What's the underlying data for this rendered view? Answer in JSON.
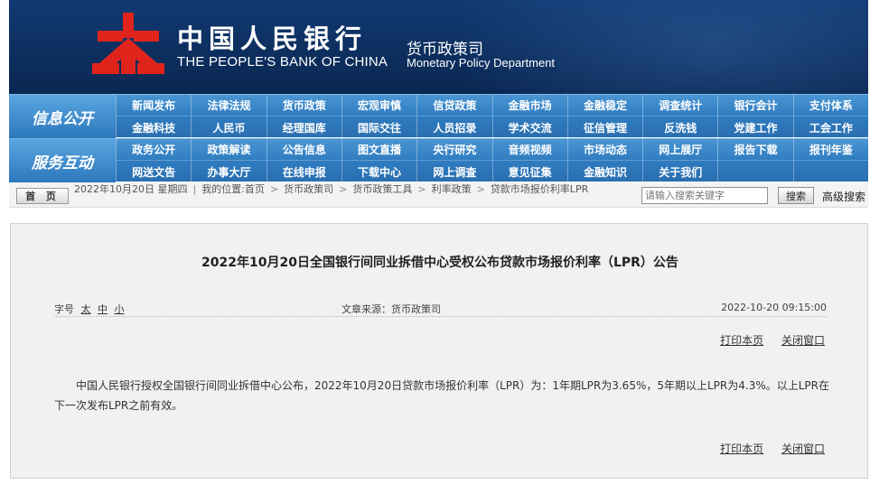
{
  "header": {
    "bank_name_cn": "中国人民银行",
    "bank_name_en": "THE PEOPLE'S BANK OF CHINA",
    "dept_cn": "货币政策司",
    "dept_en": "Monetary Policy Department",
    "colors": {
      "banner": "#0d2f5f",
      "emblem": "#e0241b",
      "nav": "#2f7cc0"
    }
  },
  "nav": {
    "info": {
      "title": "信息公开",
      "items": [
        "新闻发布",
        "法律法规",
        "货币政策",
        "宏观审慎",
        "信贷政策",
        "金融市场",
        "金融稳定",
        "调查统计",
        "银行会计",
        "支付体系",
        "金融科技",
        "人民币",
        "经理国库",
        "国际交往",
        "人员招录",
        "学术交流",
        "征信管理",
        "反洗钱",
        "党建工作",
        "工会工作"
      ]
    },
    "service": {
      "title": "服务互动",
      "items": [
        "政务公开",
        "政策解读",
        "公告信息",
        "图文直播",
        "央行研究",
        "音频视频",
        "市场动态",
        "网上展厅",
        "报告下载",
        "报刊年鉴",
        "网送文告",
        "办事大厅",
        "在线申报",
        "下载中心",
        "网上调查",
        "意见征集",
        "金融知识",
        "关于我们"
      ]
    }
  },
  "crumb": {
    "home": "首 页",
    "date": "2022年10月20日 星期四",
    "location_label": "我的位置:首页",
    "path": [
      "货币政策司",
      "货币政策工具",
      "利率政策",
      "贷款市场报价利率LPR"
    ]
  },
  "search": {
    "placeholder": "请输入搜索关键字",
    "button": "搜索",
    "advanced": "高级搜索"
  },
  "article": {
    "title": "2022年10月20日全国银行间同业拆借中心受权公布贷款市场报价利率（LPR）公告",
    "font_label": "字号",
    "font_sizes": [
      "太",
      "中",
      "小"
    ],
    "source": "文章来源：货币政策司",
    "date": "2022-10-20 09:15:00",
    "print": "打印本页",
    "close": "关闭窗口",
    "body": "中国人民银行授权全国银行间同业拆借中心公布，2022年10月20日贷款市场报价利率（LPR）为：1年期LPR为3.65%，5年期以上LPR为4.3%。以上LPR在下一次发布LPR之前有效。"
  }
}
